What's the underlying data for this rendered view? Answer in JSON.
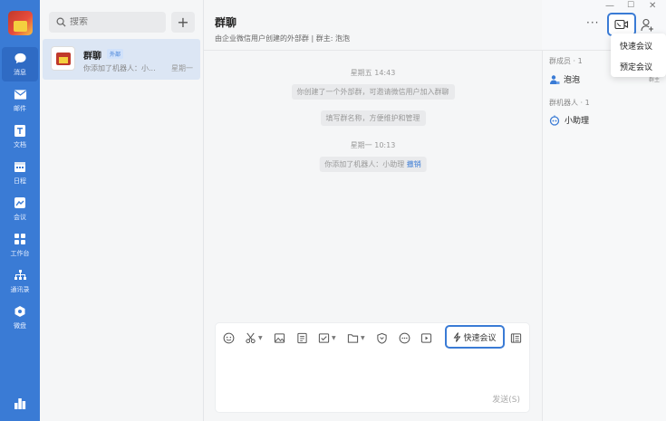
{
  "nav": {
    "items": [
      {
        "label": "消息",
        "icon": "chat-bubble-icon"
      },
      {
        "label": "邮件",
        "icon": "mail-icon"
      },
      {
        "label": "文档",
        "icon": "document-icon"
      },
      {
        "label": "日程",
        "icon": "calendar-icon"
      },
      {
        "label": "会议",
        "icon": "meeting-icon"
      },
      {
        "label": "工作台",
        "icon": "workbench-icon"
      },
      {
        "label": "通讯录",
        "icon": "contacts-icon"
      },
      {
        "label": "微盘",
        "icon": "drive-icon"
      }
    ]
  },
  "search": {
    "placeholder": "搜索"
  },
  "conversation": {
    "name": "群聊",
    "tag": "外部",
    "preview": "你添加了机器人：小...",
    "time": "星期一"
  },
  "chat": {
    "title": "群聊",
    "subtitle": "由企业微信用户创建的外部群 | 群主: 泡泡",
    "messages": [
      {
        "time": "星期五 14:43"
      },
      {
        "text": "你创建了一个外部群，可邀请微信用户加入群聊"
      },
      {
        "text": "填写群名称，方便维护和管理"
      },
      {
        "time": "星期一 10:13"
      },
      {
        "text": "你添加了机器人：小助理",
        "link": "撤销"
      }
    ],
    "quick_meeting_label": "快速会议",
    "send_label": "发送(S)"
  },
  "members": {
    "members_title": "群成员 · 1",
    "member_name": "泡泡",
    "member_role": "群主",
    "robots_title": "群机器人 · 1",
    "robot_name": "小助理"
  },
  "dropdown": {
    "options": [
      "快速会议",
      "预定会议"
    ]
  },
  "colors": {
    "accent": "#3a7bd5",
    "nav_bg": "#3a7bd5"
  }
}
